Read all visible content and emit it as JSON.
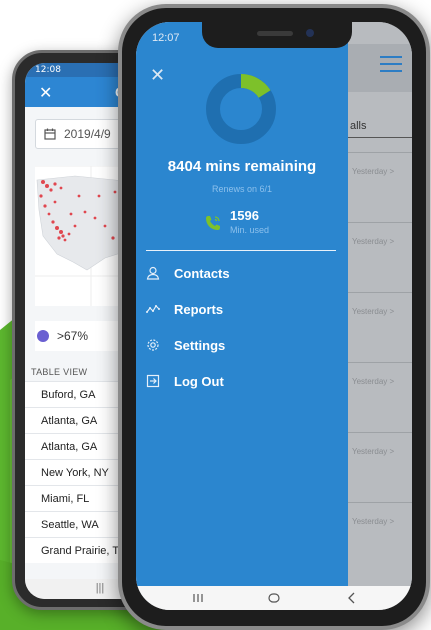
{
  "back_phone": {
    "status_time": "12:08",
    "header_title": "C",
    "date_value": "2019/4/9",
    "legend_label": ">67%",
    "table_label": "TABLE VIEW",
    "rows": [
      "Buford, GA",
      "Atlanta, GA",
      "Atlanta, GA",
      "New York, NY",
      "Miami, FL",
      "Seattle, WA",
      "Grand Prairie, T"
    ],
    "nav_label": "|||"
  },
  "front_phone": {
    "status_time": "12:07",
    "drawer": {
      "minutes_remaining": "8404 mins remaining",
      "renews": "Renews on 6/1",
      "minutes_used": "1596",
      "minutes_used_label": "Min. used",
      "usage_fraction": 0.16,
      "menu": [
        {
          "label": "Contacts",
          "icon": "person-icon"
        },
        {
          "label": "Reports",
          "icon": "reports-icon"
        },
        {
          "label": "Settings",
          "icon": "gear-icon"
        },
        {
          "label": "Log Out",
          "icon": "logout-icon"
        }
      ]
    },
    "main": {
      "tab_label": "alls",
      "row_time": "Yesterday >"
    }
  },
  "colors": {
    "drawer_blue": "#2b86cf",
    "donut_dark": "#1f6fb0",
    "donut_green": "#7dc12a",
    "map_dot": "#e0474f",
    "legend_purple": "#6a5fd1",
    "swoosh_green": "#5db82f"
  }
}
